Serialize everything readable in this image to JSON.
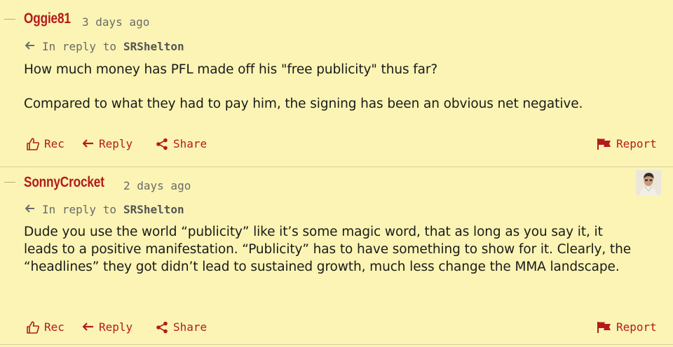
{
  "comments": [
    {
      "username": "Oggie81",
      "time": "3 days ago",
      "reply_prefix": "In reply to",
      "reply_to": "SRShelton",
      "paragraphs": [
        "How much money has PFL made off his \"free publicity\" thus far?",
        "Compared to what they had to pay him, the signing has been an obvious net negative."
      ],
      "actions": {
        "rec": "Rec",
        "reply": "Reply",
        "share": "Share",
        "report": "Report"
      }
    },
    {
      "username": "SonnyCrocket",
      "time": "2 days ago",
      "reply_prefix": "In reply to",
      "reply_to": "SRShelton",
      "paragraphs": [
        "Dude you use the world “publicity” like it’s some magic word, that as long as you say it, it leads to a positive manifestation. “Publicity” has to have something to show for it. Clearly, the “headlines” they got didn’t lead to sustained growth, much less change the MMA landscape."
      ],
      "actions": {
        "rec": "Rec",
        "reply": "Reply",
        "share": "Share",
        "report": "Report"
      }
    }
  ],
  "colors": {
    "background": "#fbf4b4",
    "accent": "#b31b1b",
    "muted_text": "#6a6a6a"
  }
}
